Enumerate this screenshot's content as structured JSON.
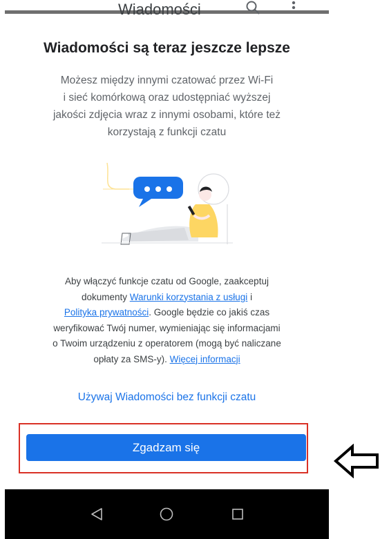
{
  "app_bar": {
    "title": "Wiadomości",
    "search_icon": "search-icon",
    "more_icon": "more-vert-icon"
  },
  "dialog": {
    "title": "Wiadomości są teraz jeszcze lepsze",
    "body_lines": [
      "Możesz między innymi czatować przez Wi-Fi",
      "i sieć komórkową oraz udostępniać wyższej",
      "jakości zdjęcia wraz z innymi osobami, które też",
      "korzystają z funkcji czatu"
    ],
    "legal": {
      "part1": "Aby włączyć funkcje czatu od Google, zaakceptuj",
      "part2": "dokumenty ",
      "terms_link": "Warunki korzystania z usługi",
      "part3": " i",
      "privacy_link": "Polityka prywatności",
      "part4": ". Google będzie co jakiś czas",
      "part5": "weryfikować Twój numer, wymieniając się informacjami",
      "part6": "o Twoim urządzeniu z operatorem (mogą być naliczane",
      "part7": "opłaty za SMS-y). ",
      "more_info_link": "Więcej informacji"
    },
    "no_chat_link": "Używaj Wiadomości bez funkcji czatu",
    "agree_button": "Zgadzam się"
  },
  "nav_bar": {
    "back_icon": "back-triangle-icon",
    "home_icon": "home-circle-icon",
    "recents_icon": "recents-square-icon"
  },
  "annotation": {
    "highlight_color": "#d93025",
    "arrow_icon": "left-arrow-icon"
  },
  "colors": {
    "accent": "#1a73e8",
    "title_text": "#202124",
    "body_text": "#5f6368",
    "nav_background": "#000000"
  }
}
